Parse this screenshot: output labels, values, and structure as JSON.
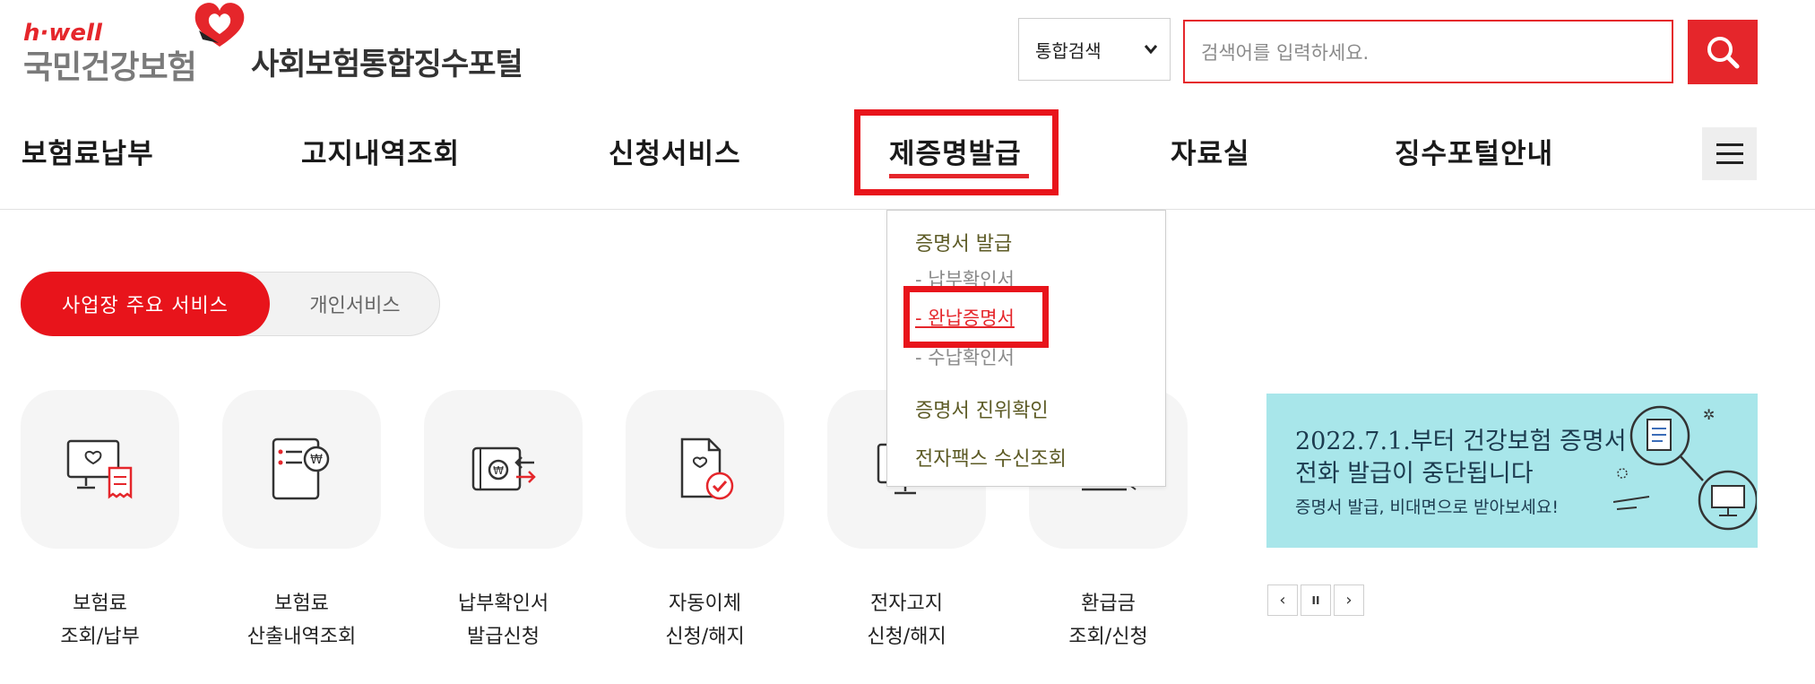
{
  "header": {
    "brand_small": "h·well",
    "brand_name": "국민건강보험",
    "portal_title": "사회보험통합징수포털"
  },
  "search": {
    "scope_selected": "통합검색",
    "placeholder": "검색어를 입력하세요."
  },
  "nav": {
    "items": [
      {
        "label": "보험료납부"
      },
      {
        "label": "고지내역조회"
      },
      {
        "label": "신청서비스"
      },
      {
        "label": "제증명발급"
      },
      {
        "label": "자료실"
      },
      {
        "label": "징수포털안내"
      }
    ],
    "active_index": 3
  },
  "dropdown": {
    "group1": "증명서 발급",
    "sub1": "- 납부확인서",
    "sub2": "- 완납증명서",
    "sub3": "- 수납확인서",
    "item2": "증명서 진위확인",
    "item3": "전자팩스 수신조회"
  },
  "service_toggle": {
    "active_label": "사업장 주요 서비스",
    "inactive_label": "개인서비스"
  },
  "services": [
    {
      "line1": "보험료",
      "line2": "조회/납부",
      "icon": "monitor-receipt-icon"
    },
    {
      "line1": "보험료",
      "line2": "산출내역조회",
      "icon": "document-won-icon"
    },
    {
      "line1": "납부확인서",
      "line2": "발급신청",
      "icon": "wallet-transfer-icon"
    },
    {
      "line1": "자동이체",
      "line2": "신청/해지",
      "icon": "document-check-icon"
    },
    {
      "line1": "전자고지",
      "line2": "신청/해지",
      "icon": "monitor-icon"
    },
    {
      "line1": "환급금",
      "line2": "조회/신청",
      "icon": "refund-icon"
    }
  ],
  "banner": {
    "line1": "2022.7.1.부터 건강보험 증명서",
    "line2": "전화 발급이 중단됩니다",
    "line3": "증명서 발급, 비대면으로 받아보세요!"
  },
  "slider": {
    "prev": "‹",
    "pause": "II",
    "next": "›"
  },
  "colors": {
    "accent": "#e5262b",
    "banner_bg": "#a8e6ea",
    "dropdown_text": "#5d5b26"
  }
}
